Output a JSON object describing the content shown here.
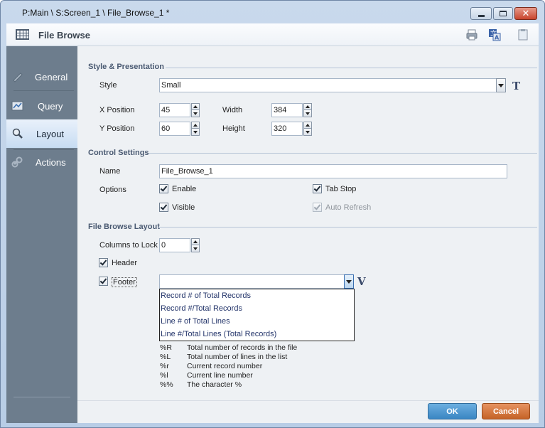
{
  "window": {
    "title": "P:Main \\ S:Screen_1 \\ File_Browse_1 *"
  },
  "header": {
    "title": "File Browse"
  },
  "sidebar": {
    "items": [
      {
        "label": "General"
      },
      {
        "label": "Query"
      },
      {
        "label": "Layout"
      },
      {
        "label": "Actions"
      }
    ],
    "active": "Layout"
  },
  "style_section": {
    "title": "Style & Presentation",
    "style_label": "Style",
    "style_value": "Small",
    "style_button": "T",
    "x_label": "X Position",
    "x_value": "45",
    "y_label": "Y Position",
    "y_value": "60",
    "width_label": "Width",
    "width_value": "384",
    "height_label": "Height",
    "height_value": "320"
  },
  "control_section": {
    "title": "Control Settings",
    "name_label": "Name",
    "name_value": "File_Browse_1",
    "options_label": "Options",
    "enable_label": "Enable",
    "tabstop_label": "Tab Stop",
    "visible_label": "Visible",
    "autorefresh_label": "Auto Refresh"
  },
  "layout_section": {
    "title": "File Browse Layout",
    "columns_label": "Columns to Lock",
    "columns_value": "0",
    "header_label": "Header",
    "footer_label": "Footer",
    "footer_value": "",
    "footer_button": "V",
    "footer_options": [
      "Record # of Total Records",
      "Record #/Total Records",
      "Line # of Total Lines",
      "Line #/Total Lines (Total Records)"
    ],
    "tokens": [
      {
        "code": "%R",
        "desc": "Total number of records in the file"
      },
      {
        "code": "%L",
        "desc": "Total number of lines in the list"
      },
      {
        "code": "%r",
        "desc": "Current record number"
      },
      {
        "code": "%l",
        "desc": "Current line number"
      },
      {
        "code": "%%",
        "desc": "The character %"
      }
    ]
  },
  "footer": {
    "ok": "OK",
    "cancel": "Cancel"
  },
  "colors": {
    "sidebar": "#6d7d8d",
    "ok": "#3a86c3",
    "cancel": "#c56327",
    "section_title": "#4a5a72"
  }
}
